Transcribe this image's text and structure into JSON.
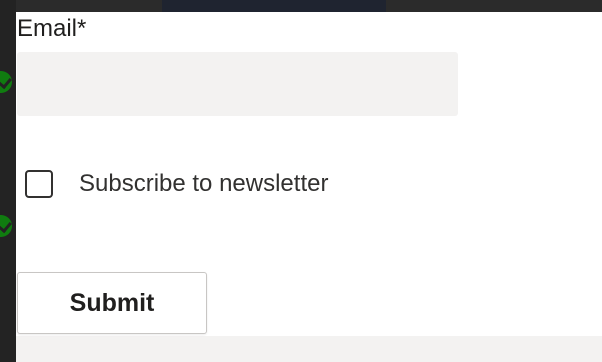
{
  "form": {
    "email_label": "Email*",
    "email_value": "",
    "email_placeholder": "",
    "newsletter_label": "Subscribe to newsletter",
    "newsletter_checked": false,
    "submit_label": "Submit"
  },
  "icons": {
    "status": "check-circle-icon"
  },
  "colors": {
    "input_background": "#f3f2f1",
    "text": "#201f1e",
    "status_icon": "#107c10"
  }
}
